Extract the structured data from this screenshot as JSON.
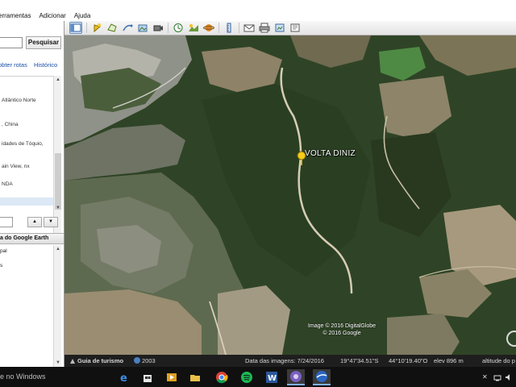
{
  "menubar": {
    "items": [
      "erramentas",
      "Adicionar",
      "Ajuda"
    ]
  },
  "search": {
    "button_label": "Pesquisar",
    "route_link": "obter rotas",
    "history_link": "Histórico"
  },
  "results": {
    "items": [
      "Atlântico Norte",
      ", China",
      "idades de Tóquio,",
      "ain View, nx",
      "NDA"
    ]
  },
  "places": {
    "header": "a do Google Earth",
    "items": [
      "pal",
      "s"
    ]
  },
  "map": {
    "placemark_label": "VOLTA DINIZ",
    "copyright_line1": "Image © 2016 DigitalGlobe",
    "copyright_line2": "© 2016 Google"
  },
  "statusbar": {
    "tour_label": "Guia de turismo",
    "year": "2003",
    "imagery_date": "Data das imagens: 7/24/2016",
    "latitude": "19°47'34.51\"S",
    "longitude": "44°10'19.40\"O",
    "elevation": "elev  896 m",
    "eye_altitude": "altitude do p"
  },
  "taskbar": {
    "search_text": "e no Windows"
  },
  "colors": {
    "forest": "#2f4426",
    "link": "#1a4fa8",
    "taskbar": "#101010"
  }
}
